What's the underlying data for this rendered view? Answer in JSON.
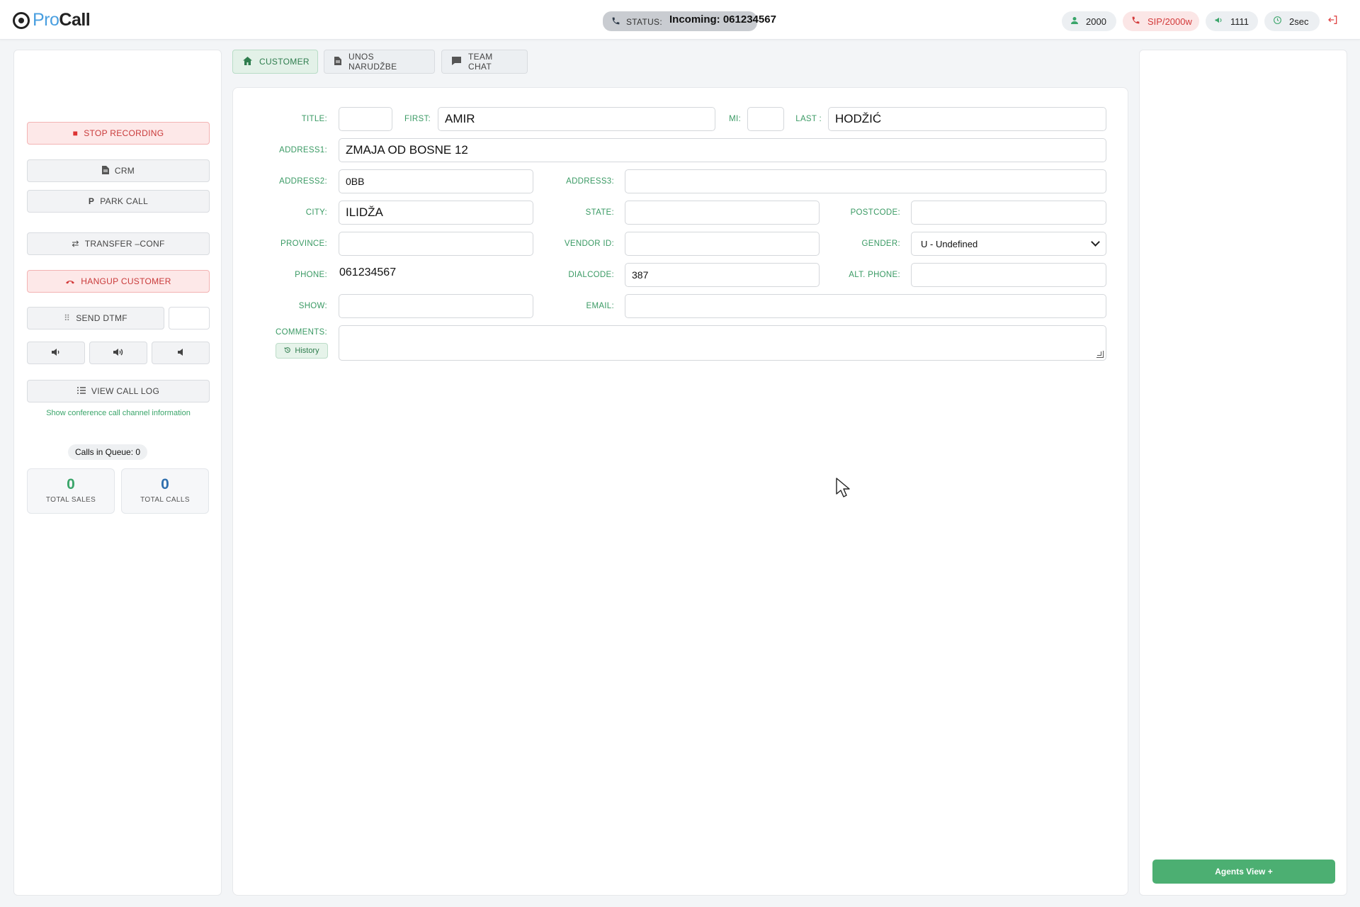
{
  "app": {
    "logo_pro": "Pro",
    "logo_call": "Call"
  },
  "header": {
    "status_label": "STATUS:",
    "status_text": "Incoming: 061234567",
    "agent_id": "2000",
    "sip": "SIP/2000w",
    "campaign": "1111",
    "timer": "2sec",
    "colors": {
      "accent": "#3aa56a",
      "danger": "#d33b3b",
      "brand_blue": "#4a9fe0"
    }
  },
  "left": {
    "stop_recording": "STOP RECORDING",
    "crm": "CRM",
    "park_call": "PARK CALL",
    "transfer_conf": "TRANSFER –CONF",
    "hangup_customer": "HANGUP CUSTOMER",
    "send_dtmf": "SEND DTMF",
    "dtmf_value": "",
    "view_call_log": "VIEW CALL LOG",
    "conference_link": "Show conference call channel information",
    "calls_in_queue": "Calls in Queue: 0",
    "stats": {
      "total_sales_value": "0",
      "total_sales_label": "TOTAL SALES",
      "total_calls_value": "0",
      "total_calls_label": "TOTAL CALLS"
    }
  },
  "tabs": [
    {
      "label": "CUSTOMER",
      "icon": "home-icon",
      "active": true
    },
    {
      "label": "UNOS NARUDŽBE",
      "icon": "document-icon",
      "active": false
    },
    {
      "label": "TEAM CHAT",
      "icon": "chat-icon",
      "active": false
    }
  ],
  "form": {
    "labels": {
      "title": "TITLE:",
      "first": "FIRST:",
      "mi": "MI:",
      "last": "LAST :",
      "address1": "ADDRESS1:",
      "address2": "ADDRESS2:",
      "address3": "ADDRESS3:",
      "city": "CITY:",
      "state": "STATE:",
      "postcode": "POSTCODE:",
      "province": "PROVINCE:",
      "vendor_id": "VENDOR ID:",
      "gender": "GENDER:",
      "phone": "PHONE:",
      "dialcode": "DIALCODE:",
      "alt_phone": "ALT. PHONE:",
      "show": "SHOW:",
      "email": "EMAIL:",
      "comments": "COMMENTS:"
    },
    "values": {
      "title": "",
      "first": "AMIR",
      "mi": "",
      "last": "HODŽIĆ",
      "address1": "ZMAJA OD BOSNE 12",
      "address2": "0BB",
      "address3": "",
      "city": "ILIDŽA",
      "state": "",
      "postcode": "",
      "province": "",
      "vendor_id": "",
      "gender": "U - Undefined",
      "phone": "061234567",
      "dialcode": "387",
      "alt_phone": "",
      "show": "",
      "email": "",
      "comments": ""
    },
    "history_button": "History"
  },
  "right": {
    "agents_view": "Agents View +"
  }
}
